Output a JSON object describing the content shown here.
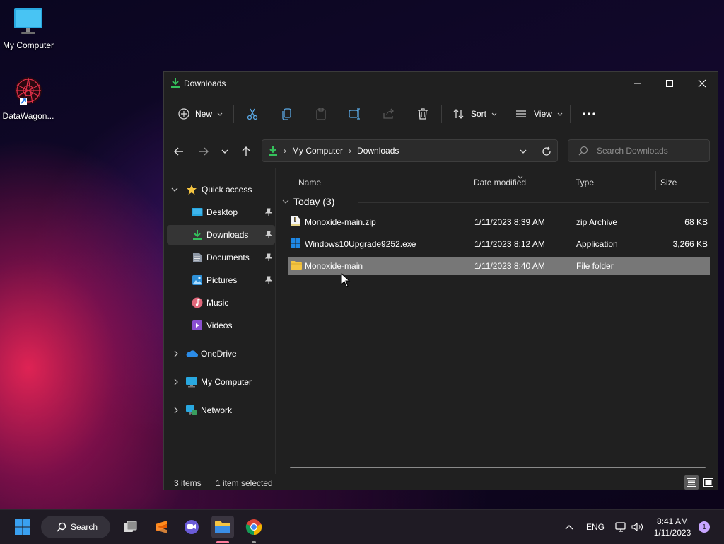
{
  "desktop": {
    "icons": [
      {
        "label": "My Computer"
      },
      {
        "label": "DataWagon..."
      }
    ]
  },
  "window": {
    "title": "Downloads",
    "toolbar": {
      "new_label": "New",
      "sort_label": "Sort",
      "view_label": "View"
    },
    "address": {
      "segments": [
        "My Computer",
        "Downloads"
      ]
    },
    "search": {
      "placeholder": "Search Downloads"
    },
    "nav": {
      "quick_access": "Quick access",
      "items": [
        {
          "label": "Desktop",
          "pinned": true
        },
        {
          "label": "Downloads",
          "pinned": true
        },
        {
          "label": "Documents",
          "pinned": true
        },
        {
          "label": "Pictures",
          "pinned": true
        },
        {
          "label": "Music",
          "pinned": false
        },
        {
          "label": "Videos",
          "pinned": false
        }
      ],
      "onedrive": "OneDrive",
      "mycomputer": "My Computer",
      "network": "Network"
    },
    "columns": [
      "Name",
      "Date modified",
      "Type",
      "Size"
    ],
    "group": {
      "label": "Today (3)"
    },
    "files": [
      {
        "name": "Monoxide-main.zip",
        "date": "1/11/2023 8:39 AM",
        "type": "zip Archive",
        "size": "68 KB"
      },
      {
        "name": "Windows10Upgrade9252.exe",
        "date": "1/11/2023 8:12 AM",
        "type": "Application",
        "size": "3,266 KB"
      },
      {
        "name": "Monoxide-main",
        "date": "1/11/2023 8:40 AM",
        "type": "File folder",
        "size": ""
      }
    ],
    "status": {
      "count": "3 items",
      "selected": "1 item selected"
    }
  },
  "taskbar": {
    "search_label": "Search",
    "language": "ENG",
    "time": "8:41 AM",
    "date": "1/11/2023",
    "notifications": "1"
  },
  "colors": {
    "window_bg": "#202020",
    "selection": "#777777",
    "accent_green": "#35c15c",
    "folder_yellow": "#f5c542"
  }
}
